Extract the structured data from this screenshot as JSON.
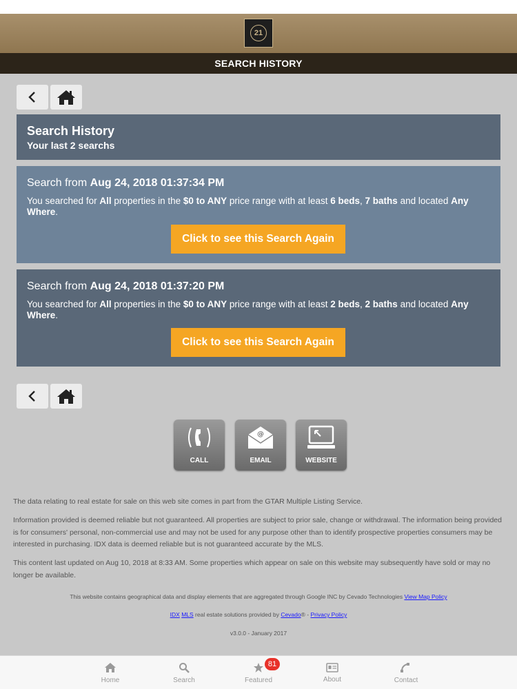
{
  "header": {
    "logo_text": "21",
    "title": "SEARCH HISTORY"
  },
  "history": {
    "title": "Search History",
    "subtitle": "Your last 2 searchs"
  },
  "searches": [
    {
      "prefix": "Search from ",
      "datetime": "Aug 24, 2018 01:37:34 PM",
      "t1": "You searched for ",
      "type": "All",
      "t2": " properties in the ",
      "price": "$0 to ANY",
      "t3": " price range with at least ",
      "beds": "6 beds",
      "t4": ", ",
      "baths": "7 baths",
      "t5": " and located ",
      "location": "Any Where",
      "t6": ".",
      "button_label": "Click to see this Search Again"
    },
    {
      "prefix": "Search from ",
      "datetime": "Aug 24, 2018 01:37:20 PM",
      "t1": "You searched for ",
      "type": "All",
      "t2": " properties in the ",
      "price": "$0 to ANY",
      "t3": " price range with at least ",
      "beds": "2 beds",
      "t4": ", ",
      "baths": "2 baths",
      "t5": " and located ",
      "location": "Any Where",
      "t6": ".",
      "button_label": "Click to see this Search Again"
    }
  ],
  "contact": {
    "call": "CALL",
    "email": "EMAIL",
    "website": "WEBSITE"
  },
  "footer": {
    "p1": "The data relating to real estate for sale on this web site comes in part from the GTAR Multiple Listing Service.",
    "p2": "Information provided is deemed reliable but not guaranteed. All properties are subject to prior sale, change or withdrawal. The information being provided is for consumers' personal, non-commercial use and may not be used for any purpose other than to identify prospective properties consumers may be interested in purchasing. IDX data is deemed reliable but is not guaranteed accurate by the MLS.",
    "p3": "This content last updated on Aug 10, 2018 at 8:33 AM. Some properties which appear on sale on this website may subsequently have sold or may no longer be available.",
    "map_text": "This website contains geographical data and display elements that are aggregated through Google INC by Cevado Technologies ",
    "map_link": "View Map Policy",
    "idx_link": "IDX",
    "mls_link": "MLS",
    "idx_text": " real estate solutions provided by ",
    "cevado_link": "Cevado",
    "reg_mark": "®",
    "dash": " - ",
    "privacy_link": "Privacy Policy",
    "version": "v3.0.0 - January 2017"
  },
  "tabs": {
    "home": "Home",
    "search": "Search",
    "featured": "Featured",
    "featured_badge": "81",
    "about": "About",
    "contact": "Contact"
  },
  "colors": {
    "header_gold": "#a8906c",
    "title_bar": "#2c2419",
    "panel_dark": "#5a6878",
    "panel_light": "#6e8399",
    "accent_orange": "#f5a623",
    "badge_red": "#e8322a"
  }
}
